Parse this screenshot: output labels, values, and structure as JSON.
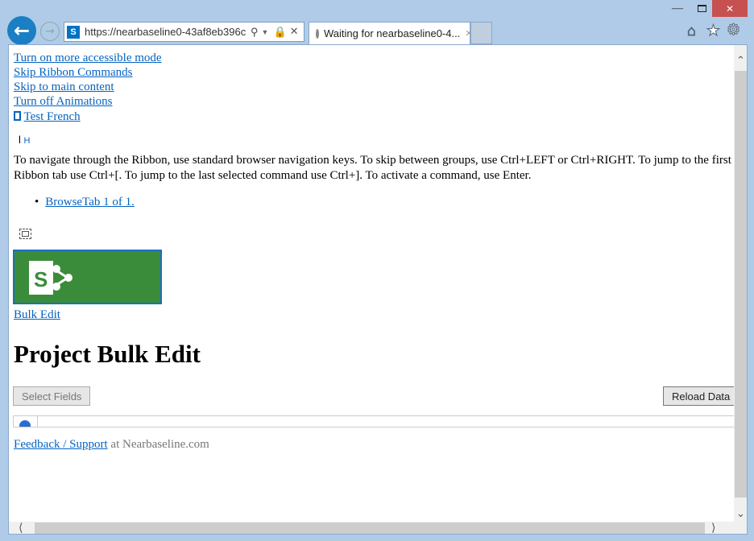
{
  "browser": {
    "address": "https://nearbaseline0-43af8eb396cb...",
    "tab_title": "Waiting for nearbaseline0-4...",
    "close_glyph": "✕"
  },
  "page": {
    "skip_links": [
      "Turn on more accessible mode",
      "Skip Ribbon Commands",
      "Skip to main content",
      "Turn off Animations"
    ],
    "language_link": "Test French",
    "marker_text": "H",
    "ribbon_help": "To navigate through the Ribbon, use standard browser navigation keys. To skip between groups, use Ctrl+LEFT or Ctrl+RIGHT. To jump to the first Ribbon tab use Ctrl+[. To jump to the last selected command use Ctrl+]. To activate a command, use Enter.",
    "browse_tab": "BrowseTab 1 of 1.",
    "site_link": "Bulk Edit",
    "title": "Project Bulk Edit",
    "select_fields": "Select Fields",
    "reload_data": "Reload Data",
    "feedback_link": "Feedback / Support",
    "feedback_suffix": " at Nearbaseline.com"
  },
  "colors": {
    "logo_bg": "#3a8c3a",
    "accent": "#0563c1",
    "close_bg": "#c75050"
  }
}
